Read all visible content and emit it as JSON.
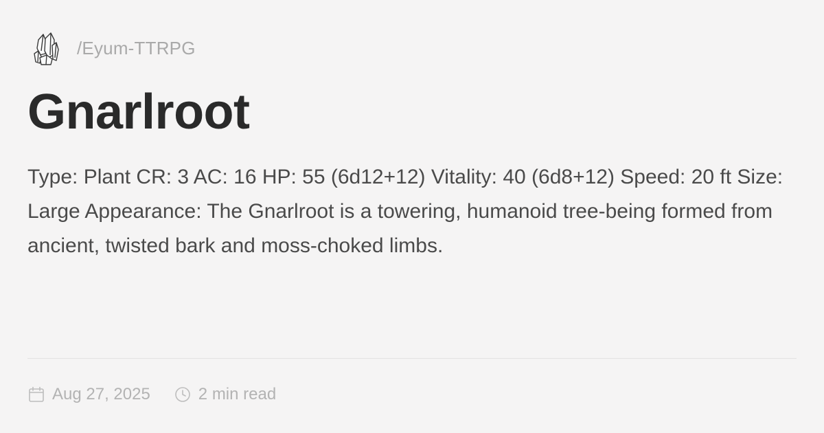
{
  "header": {
    "logo_icon": "crystal-cluster-icon",
    "site_path": "/Eyum-TTRPG"
  },
  "article": {
    "title": "Gnarlroot",
    "description": "Type: Plant CR: 3 AC: 16 HP: 55 (6d12+12) Vitality: 40 (6d8+12) Speed: 20 ft Size: Large Appearance: The Gnarlroot is a towering, humanoid tree-being formed from ancient, twisted bark and moss-choked limbs."
  },
  "meta": {
    "date_icon": "calendar-icon",
    "date": "Aug 27, 2025",
    "read_time_icon": "clock-icon",
    "read_time": "2 min read"
  },
  "colors": {
    "background": "#f5f4f4",
    "title": "#2a2a2a",
    "body_text": "#4a4a4a",
    "muted_text": "#b3b3b3"
  }
}
